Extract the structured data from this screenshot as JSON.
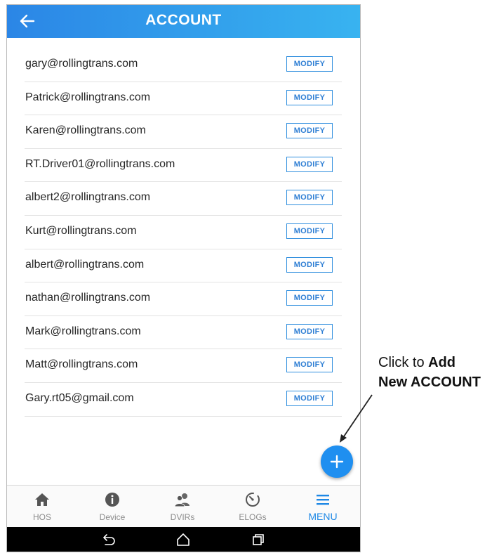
{
  "header": {
    "title": "ACCOUNT"
  },
  "accounts": [
    {
      "email": "gary@rollingtrans.com",
      "action": "MODIFY"
    },
    {
      "email": "Patrick@rollingtrans.com",
      "action": "MODIFY"
    },
    {
      "email": "Karen@rollingtrans.com",
      "action": "MODIFY"
    },
    {
      "email": "RT.Driver01@rollingtrans.com",
      "action": "MODIFY"
    },
    {
      "email": "albert2@rollingtrans.com",
      "action": "MODIFY"
    },
    {
      "email": "Kurt@rollingtrans.com",
      "action": "MODIFY"
    },
    {
      "email": "albert@rollingtrans.com",
      "action": "MODIFY"
    },
    {
      "email": "nathan@rollingtrans.com",
      "action": "MODIFY"
    },
    {
      "email": "Mark@rollingtrans.com",
      "action": "MODIFY"
    },
    {
      "email": "Matt@rollingtrans.com",
      "action": "MODIFY"
    },
    {
      "email": "Gary.rt05@gmail.com",
      "action": "MODIFY"
    }
  ],
  "fab": {
    "icon": "plus-icon"
  },
  "nav": [
    {
      "label": "HOS",
      "icon": "home-icon",
      "active": false
    },
    {
      "label": "Device",
      "icon": "info-icon",
      "active": false
    },
    {
      "label": "DVIRs",
      "icon": "people-icon",
      "active": false
    },
    {
      "label": "ELOGs",
      "icon": "timer-icon",
      "active": false
    },
    {
      "label": "MENU",
      "icon": "menu-icon",
      "active": true
    }
  ],
  "system_bar": [
    "back-icon",
    "home-outline-icon",
    "recents-icon"
  ],
  "callout": {
    "prefix": "Click to ",
    "bold_1": "Add",
    "bold_2": "New ACCOUNT"
  },
  "colors": {
    "appbar": "#2b86e6",
    "accent": "#1e88e5",
    "fab": "#1f8ff0"
  }
}
